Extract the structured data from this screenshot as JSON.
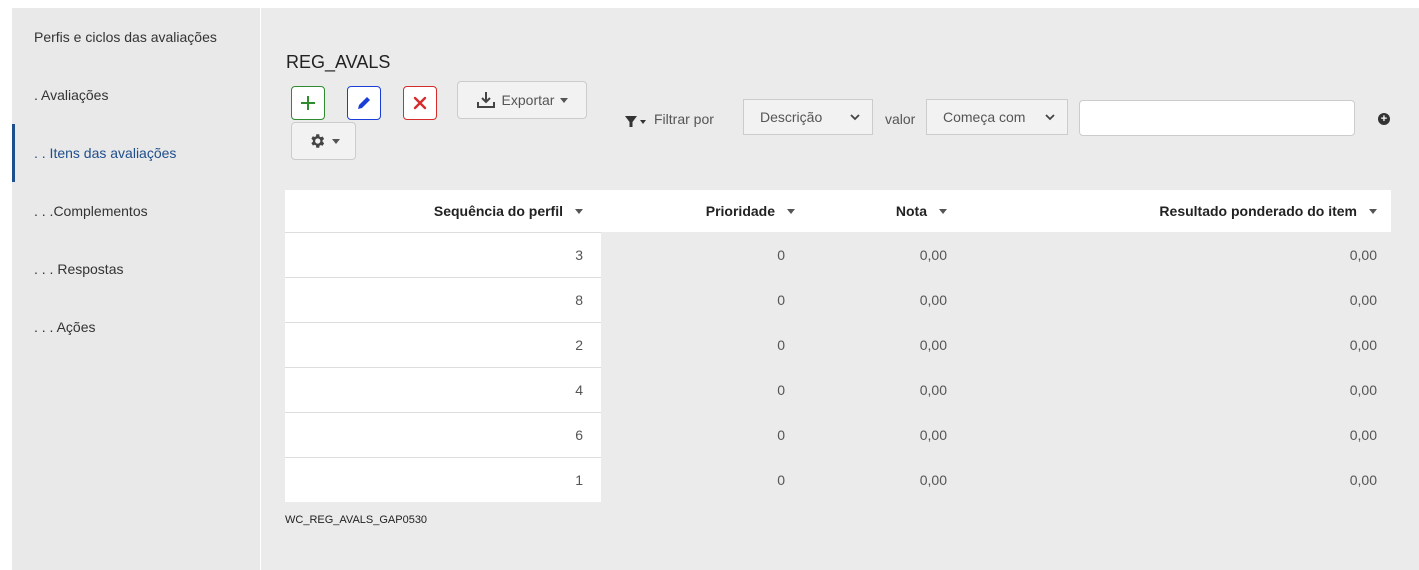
{
  "sidebar": {
    "items": [
      {
        "label": "Perfis e ciclos das avaliações",
        "active": false
      },
      {
        "label": ". Avaliações",
        "active": false
      },
      {
        "label": ". . Itens das avaliações",
        "active": true
      },
      {
        "label": ". . .Complementos",
        "active": false
      },
      {
        "label": ". . . Respostas",
        "active": false
      },
      {
        "label": ". . . Ações",
        "active": false
      }
    ]
  },
  "main": {
    "title": "REG_AVALS",
    "toolbar": {
      "add_icon": "plus-icon",
      "edit_icon": "pencil-icon",
      "delete_icon": "close-icon",
      "export_label": "Exportar",
      "settings_icon": "gear-icon"
    },
    "filter": {
      "filter_label": "Filtrar por",
      "field_selected": "Descrição",
      "value_label": "valor",
      "operator_selected": "Começa com",
      "search_value": "",
      "add_icon": "plus-circle-icon"
    },
    "table": {
      "columns": [
        "Sequência do perfil",
        "Prioridade",
        "Nota",
        "Resultado ponderado do item"
      ],
      "rows": [
        {
          "seq": "3",
          "prioridade": "0",
          "nota": "0,00",
          "resultado": "0,00"
        },
        {
          "seq": "8",
          "prioridade": "0",
          "nota": "0,00",
          "resultado": "0,00"
        },
        {
          "seq": "2",
          "prioridade": "0",
          "nota": "0,00",
          "resultado": "0,00"
        },
        {
          "seq": "4",
          "prioridade": "0",
          "nota": "0,00",
          "resultado": "0,00"
        },
        {
          "seq": "6",
          "prioridade": "0",
          "nota": "0,00",
          "resultado": "0,00"
        },
        {
          "seq": "1",
          "prioridade": "0",
          "nota": "0,00",
          "resultado": "0,00"
        }
      ]
    },
    "footer_code": "WC_REG_AVALS_GAP0530"
  },
  "colors": {
    "add": "#2e8b2e",
    "edit": "#1a3fd9",
    "delete": "#d62c2c",
    "active_nav": "#1f4e8c"
  }
}
